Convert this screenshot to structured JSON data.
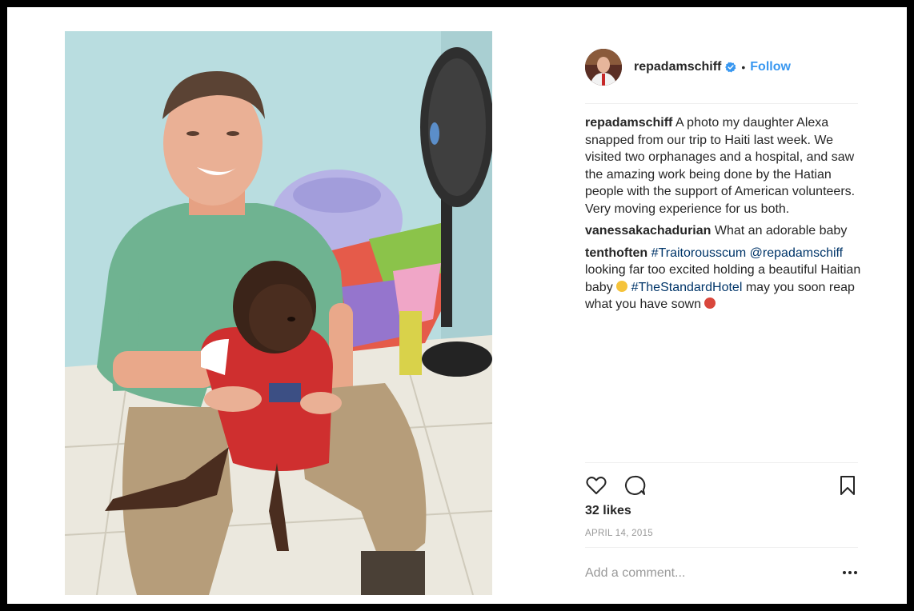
{
  "post": {
    "username": "repadamschiff",
    "separator": "•",
    "follow_label": "Follow",
    "icons": {
      "verified": "verified-badge-icon",
      "like": "heart-icon",
      "comment": "speech-bubble-icon",
      "save": "bookmark-icon",
      "more": "ellipsis-icon"
    },
    "caption": {
      "author": "repadamschiff",
      "text": "A photo my daughter Alexa snapped from our trip to Haiti last week. We visited two orphanages and a hospital, and saw the amazing work being done by the Hatian people with the support of American volunteers. Very moving experience for us both."
    },
    "comments": [
      {
        "author": "vanessakachadurian",
        "text": "What an adorable baby"
      },
      {
        "author": "tenthoften",
        "hashtag1": "#Traitorousscum",
        "mention": "@repadamschiff",
        "text1": "looking far too excited holding a beautiful Haitian baby",
        "hashtag2": "#TheStandardHotel",
        "text2": "may you soon reap what you have sown"
      }
    ],
    "likes": "32 likes",
    "date": "APRIL 14, 2015",
    "add_comment_placeholder": "Add a comment..."
  },
  "colors": {
    "link_blue": "#3897f0",
    "hashtag": "#003569",
    "verified": "#3897f0",
    "muted": "#999999"
  }
}
